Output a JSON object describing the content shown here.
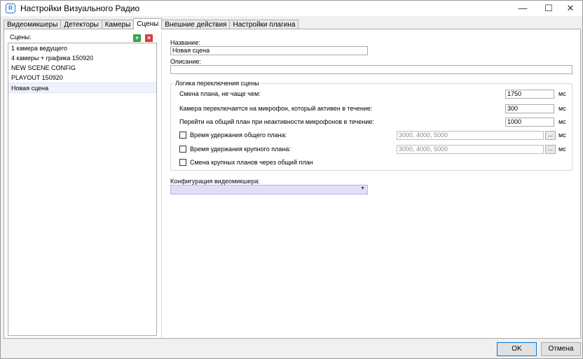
{
  "window": {
    "title": "Настройки Визуального Радио",
    "minimize_glyph": "—",
    "maximize_glyph": "☐",
    "close_glyph": "✕"
  },
  "tabs": [
    {
      "label": "Видеомикшеры",
      "active": false
    },
    {
      "label": "Детекторы",
      "active": false
    },
    {
      "label": "Камеры",
      "active": false
    },
    {
      "label": "Сцены",
      "active": true
    },
    {
      "label": "Внешние действия",
      "active": false
    },
    {
      "label": "Настройки плагина",
      "active": false
    }
  ],
  "scenes": {
    "label": "Сцены:",
    "add_icon": "add-scene-icon",
    "delete_icon": "delete-scene-icon",
    "items": [
      {
        "label": "1 камера ведущего",
        "selected": false
      },
      {
        "label": "4 камеры + графика 150920",
        "selected": false
      },
      {
        "label": "NEW SCENE CONFIG",
        "selected": false
      },
      {
        "label": "PLAYOUT 150920",
        "selected": false
      },
      {
        "label": "Новая сцена",
        "selected": true
      }
    ]
  },
  "details": {
    "name_label": "Название:",
    "name_value": "Новая сцена",
    "description_label": "Описание:",
    "description_value": ""
  },
  "logic": {
    "title": "Логика переключения сцены",
    "change_plan_label": "Смена плана, не чаще чем:",
    "change_plan_value": "1750",
    "camera_switch_label": "Камера переключается на микрофон, который активен в течение:",
    "camera_switch_value": "300",
    "wide_plan_label": "Перейти на общий план при неактивности микрофонов в течение:",
    "wide_plan_value": "1000",
    "hold_wide_label": "Время удержания общего плана:",
    "hold_wide_value": "3000, 4000, 5000",
    "hold_wide_checked": false,
    "hold_close_label": "Время удержания крупного плана:",
    "hold_close_value": "3000, 4000, 5000",
    "hold_close_checked": false,
    "close_via_wide_label": "Смена крупных планов через общий план",
    "close_via_wide_checked": false,
    "unit": "мс",
    "browse_label": "..."
  },
  "mixer": {
    "label": "Конфигурация видеомикшера:",
    "selected_value": ""
  },
  "buttons": {
    "ok": "OK",
    "cancel": "Отмена"
  },
  "colors": {
    "accent": "#0078d7",
    "combo_bg": "#e2def8",
    "selected_row": "#eef2fb"
  }
}
